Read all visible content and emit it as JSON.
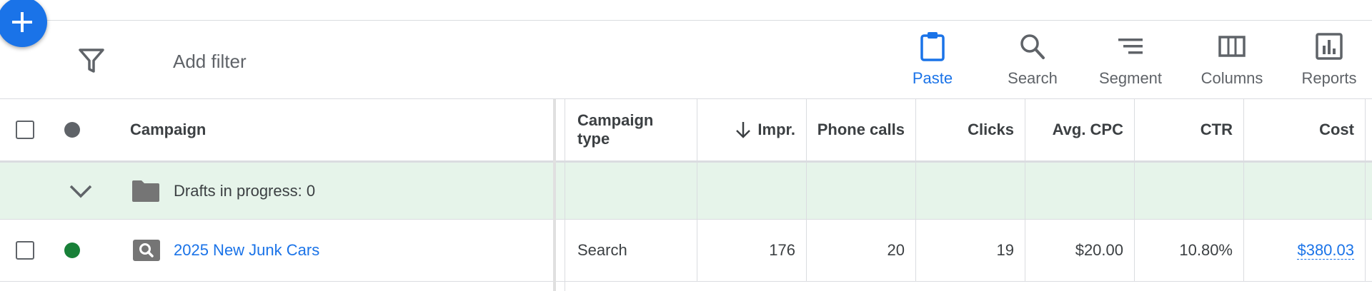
{
  "colors": {
    "accent": "#1a73e8",
    "drafts_row_bg": "#e6f4ea",
    "enabled_status": "#188038",
    "header_status": "#5f6368"
  },
  "fab": {
    "icon": "plus-icon"
  },
  "filter": {
    "icon": "filter-funnel-icon",
    "label": "Add filter"
  },
  "toolbar": {
    "items": [
      {
        "label": "Paste",
        "icon": "clipboard-icon",
        "active": true
      },
      {
        "label": "Search",
        "icon": "search-icon"
      },
      {
        "label": "Segment",
        "icon": "segment-icon"
      },
      {
        "label": "Columns",
        "icon": "columns-icon"
      },
      {
        "label": "Reports",
        "icon": "reports-icon"
      }
    ]
  },
  "table": {
    "headers": {
      "campaign": "Campaign",
      "campaign_type_line1": "Campaign",
      "campaign_type_line2": "type",
      "impr": "Impr.",
      "phone_calls": "Phone calls",
      "clicks": "Clicks",
      "avg_cpc": "Avg. CPC",
      "ctr": "CTR",
      "cost": "Cost"
    },
    "sort": {
      "column": "impr",
      "direction": "descending",
      "icon": "arrow-down-icon"
    },
    "drafts_row": {
      "label": "Drafts in progress: 0",
      "icons": [
        "chevron-down-icon",
        "folder-icon"
      ]
    },
    "rows": [
      {
        "status": "enabled",
        "campaign_icon": "search-campaign-icon",
        "campaign": "2025 New Junk Cars",
        "campaign_type": "Search",
        "impr": "176",
        "phone_calls": "20",
        "clicks": "19",
        "avg_cpc": "$20.00",
        "ctr": "10.80%",
        "cost": "$380.03"
      }
    ]
  }
}
